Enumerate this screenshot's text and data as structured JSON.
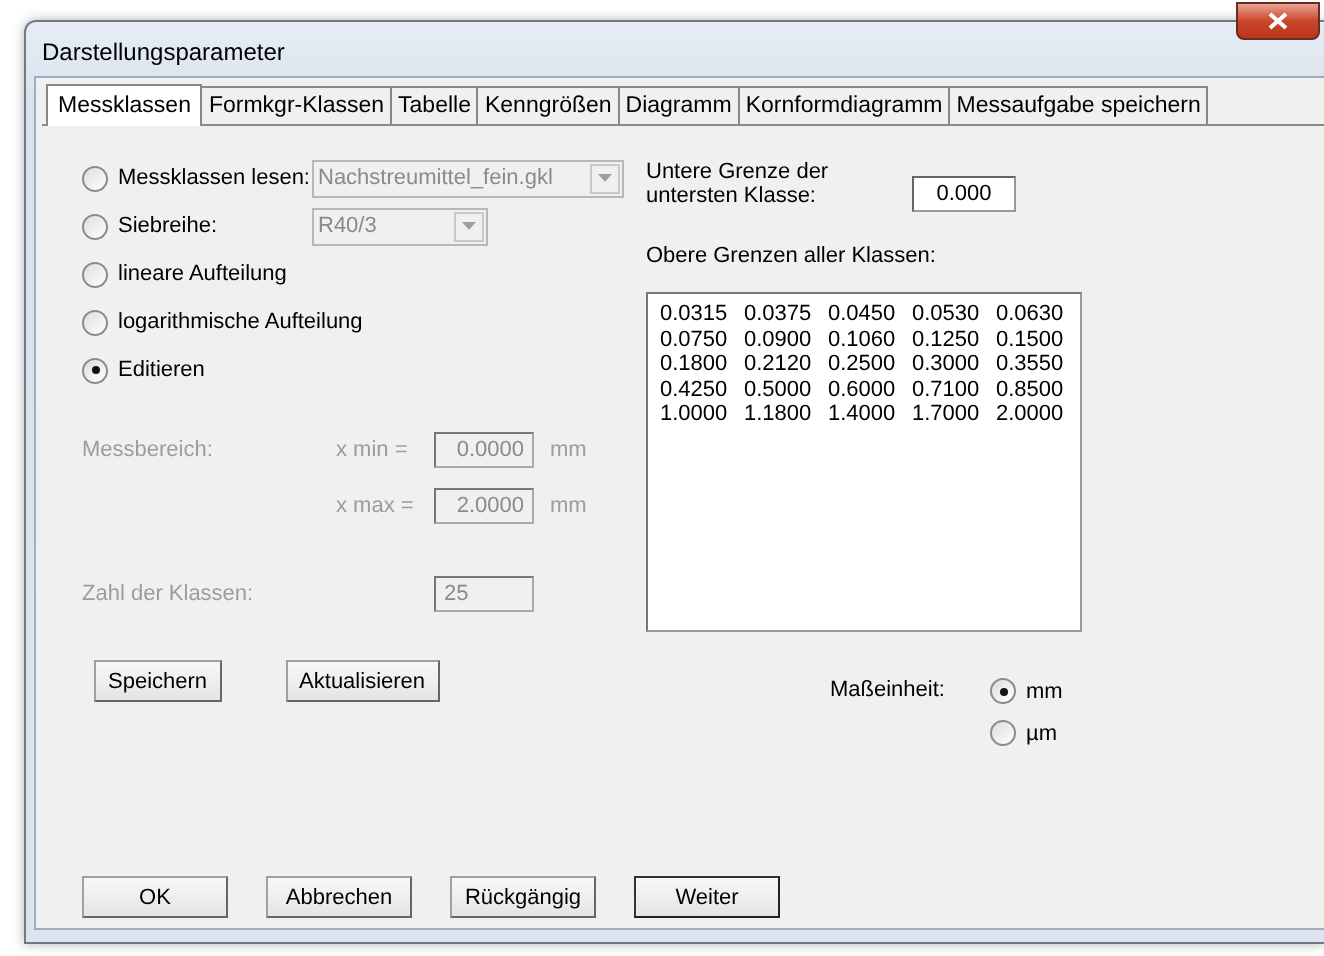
{
  "window": {
    "title": "Darstellungsparameter"
  },
  "tabs": [
    {
      "label": "Messklassen",
      "selected": true
    },
    {
      "label": "Formkgr-Klassen",
      "selected": false
    },
    {
      "label": "Tabelle",
      "selected": false
    },
    {
      "label": "Kenngrößen",
      "selected": false
    },
    {
      "label": "Diagramm",
      "selected": false
    },
    {
      "label": "Kornformdiagramm",
      "selected": false
    },
    {
      "label": "Messaufgabe speichern",
      "selected": false
    }
  ],
  "source_options": [
    {
      "kind": "combo",
      "label": "Messklassen lesen:",
      "selected": false,
      "value": "Nachstreumittel_fein.gkl",
      "disabled": true
    },
    {
      "kind": "combo",
      "label": "Siebreihe:",
      "selected": false,
      "value": "R40/3",
      "disabled": true
    },
    {
      "kind": "plain",
      "label": "lineare Aufteilung",
      "selected": false
    },
    {
      "kind": "plain",
      "label": "logarithmische Aufteilung",
      "selected": false
    },
    {
      "kind": "plain",
      "label": "Editieren",
      "selected": true
    }
  ],
  "range": {
    "label": "Messbereich:",
    "disabled": true,
    "rows": [
      {
        "label": "x min =",
        "value": "0.0000",
        "unit": "mm"
      },
      {
        "label": "x max =",
        "value": "2.0000",
        "unit": "mm"
      }
    ]
  },
  "class_count": {
    "label": "Zahl der Klassen:",
    "value": "25",
    "disabled": true
  },
  "lower_limit": {
    "label_lines": [
      "Untere Grenze der",
      "untersten Klasse:"
    ],
    "value": "0.000"
  },
  "upper_limits": {
    "label": "Obere Grenzen aller Klassen:",
    "rows": [
      [
        "0.0315",
        "0.0375",
        "0.0450",
        "0.0530",
        "0.0630"
      ],
      [
        "0.0750",
        "0.0900",
        "0.1060",
        "0.1250",
        "0.1500"
      ],
      [
        "0.1800",
        "0.2120",
        "0.2500",
        "0.3000",
        "0.3550"
      ],
      [
        "0.4250",
        "0.5000",
        "0.6000",
        "0.7100",
        "0.8500"
      ],
      [
        "1.0000",
        "1.1800",
        "1.4000",
        "1.7000",
        "2.0000"
      ]
    ]
  },
  "action_buttons": [
    "Speichern",
    "Aktualisieren"
  ],
  "unit": {
    "label": "Maßeinheit:",
    "options": [
      {
        "label": "mm",
        "selected": true
      },
      {
        "label": "µm",
        "selected": false
      }
    ]
  },
  "dialog_buttons": [
    {
      "label": "OK",
      "default": false
    },
    {
      "label": "Abbrechen",
      "default": false
    },
    {
      "label": "Rückgängig",
      "default": false
    },
    {
      "label": "Weiter",
      "default": true
    }
  ]
}
